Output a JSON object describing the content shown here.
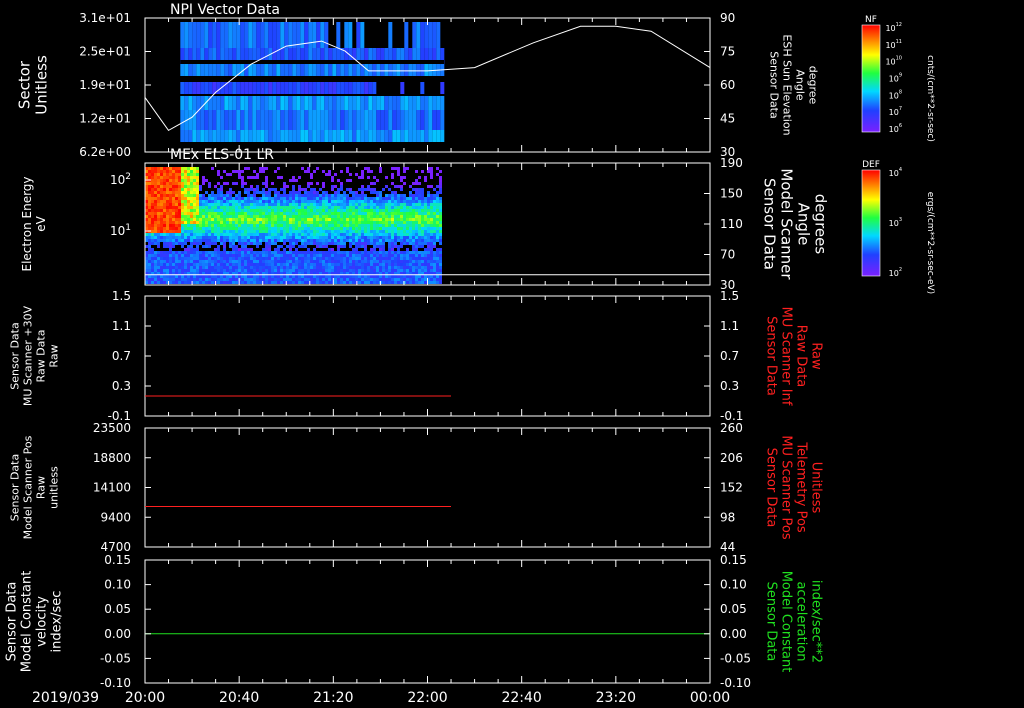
{
  "chart_data": [
    {
      "type": "heatmap",
      "title": "NPI Vector Data",
      "ylabel": [
        "Sector",
        "Unitless"
      ],
      "y_ticks": [
        "3.1e+01",
        "2.5e+01",
        "1.9e+01",
        "1.2e+01",
        "6.2e+00"
      ],
      "y2label": [
        "Sensor Data",
        "ESH Sun Elevation",
        "Angle",
        "degree"
      ],
      "y2_ticks": [
        "90",
        "75",
        "60",
        "45",
        "30"
      ],
      "y2lim": [
        15,
        90
      ],
      "y2_series_color": "#ffffff",
      "y2_series": {
        "name": "ESH Sun Elevation Angle",
        "x": [
          0,
          10,
          20,
          30,
          45,
          60,
          75,
          85,
          95,
          120,
          140,
          165,
          185,
          200,
          215,
          240
        ],
        "y": [
          42,
          22,
          30,
          45,
          62,
          73,
          76,
          70,
          58,
          58,
          60,
          75,
          85,
          85,
          82,
          60
        ]
      },
      "data_extent_minutes": [
        15,
        127
      ],
      "colorbar": {
        "label": "NF",
        "units": "cnts/(cm**2-sr-sec)",
        "ticks": [
          "10^12",
          "10^11",
          "10^10",
          "10^9",
          "10^8",
          "10^7",
          "10^6"
        ]
      }
    },
    {
      "type": "heatmap",
      "title": "MEx ELS-01 LR",
      "ylabel": [
        "Electron Energy",
        "eV"
      ],
      "y_ticks": [
        "10^2",
        "10^1"
      ],
      "y2label": [
        "Sensor Data",
        "Model Scanner",
        "Angle",
        "degrees"
      ],
      "y2_ticks": [
        "190",
        "150",
        "110",
        "70",
        "30"
      ],
      "y2lim": [
        0,
        190
      ],
      "y2_series": {
        "name": "Scanner Angle",
        "value": 16
      },
      "data_extent_minutes": [
        0,
        125
      ],
      "colorbar": {
        "label": "DEF",
        "units": "ergs/(cm**2-sr-sec-eV)",
        "ticks": [
          "10^4",
          "10^3",
          "10^2"
        ]
      }
    },
    {
      "type": "line",
      "ylabel": [
        "Sensor Data",
        "MU Scanner +30V",
        "Raw Data",
        "Raw"
      ],
      "y_ticks": [
        "1.5",
        "1.1",
        "0.7",
        "0.3",
        "-0.1"
      ],
      "ylim": [
        -0.3,
        1.5
      ],
      "y2label": [
        "Sensor Data",
        "MU Scanner Inf",
        "Raw Data",
        "Raw"
      ],
      "y2_ticks": [
        "1.5",
        "1.1",
        "0.7",
        "0.3",
        "-0.1"
      ],
      "y2_color": "#ff2020",
      "series": [
        {
          "color": "#ff2020",
          "x": [
            0,
            130
          ],
          "y": [
            0.0,
            0.0
          ]
        }
      ]
    },
    {
      "type": "line",
      "ylabel": [
        "Sensor Data",
        "Model Scanner Pos",
        "Raw",
        "unitless"
      ],
      "y_ticks": [
        "23500",
        "18800",
        "14100",
        "9400",
        "4700"
      ],
      "ylim": [
        0,
        23500
      ],
      "y2label": [
        "Sensor Data",
        "MU Scanner Pos",
        "Telemetry Pos",
        "Unitless"
      ],
      "y2_ticks": [
        "260",
        "206",
        "152",
        "98",
        "44"
      ],
      "y2_color": "#ff2020",
      "series": [
        {
          "color": "#ff2020",
          "x": [
            0,
            130
          ],
          "y": [
            8000,
            8000
          ]
        }
      ]
    },
    {
      "type": "line",
      "ylabel": [
        "Sensor Data",
        "Model Constant",
        "velocity",
        "index/sec"
      ],
      "y_ticks": [
        "0.15",
        "0.10",
        "0.05",
        "0.00",
        "-0.05",
        "-0.10"
      ],
      "ylim": [
        -0.1,
        0.15
      ],
      "y2label": [
        "Sensor Data",
        "Model Constant",
        "acceleration",
        "index/sec**2"
      ],
      "y2_ticks": [
        "0.15",
        "0.10",
        "0.05",
        "0.00",
        "-0.05",
        "-0.10"
      ],
      "y2_color": "#20e020",
      "series": [
        {
          "color": "#20e020",
          "x": [
            0,
            240
          ],
          "y": [
            0.0,
            0.0
          ]
        }
      ]
    }
  ],
  "x_axis": {
    "date": "2019/039",
    "ticks": [
      "20:00",
      "20:40",
      "21:20",
      "22:00",
      "22:40",
      "23:20",
      "00:00"
    ],
    "range_minutes": [
      0,
      240
    ]
  }
}
